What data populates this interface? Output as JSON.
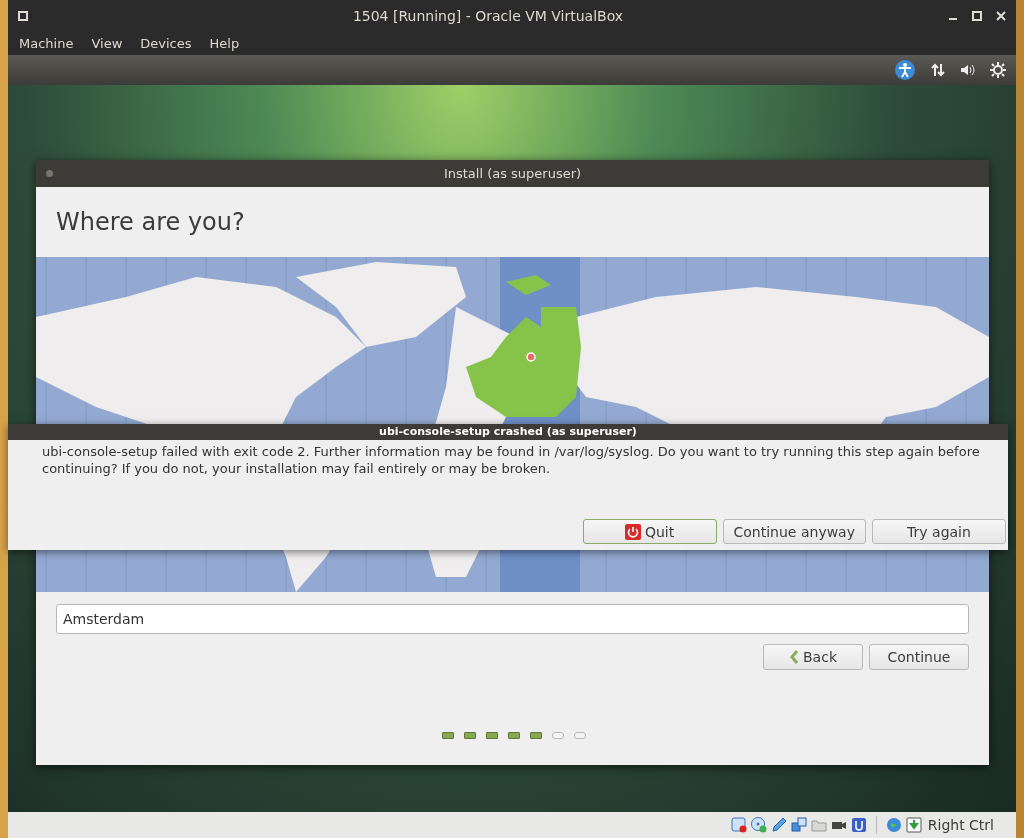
{
  "window": {
    "title": "1504 [Running] - Oracle VM VirtualBox"
  },
  "menu": [
    "Machine",
    "View",
    "Devices",
    "Help"
  ],
  "installer": {
    "title": "Install (as superuser)",
    "heading": "Where are you?",
    "location": {
      "value": "Amsterdam"
    },
    "buttons": [
      {
        "label": "Back",
        "kind": "back"
      },
      {
        "label": "Continue",
        "kind": "plain"
      }
    ],
    "steps": [
      {
        "done": true
      },
      {
        "done": true
      },
      {
        "done": true
      },
      {
        "done": true
      },
      {
        "done": true
      },
      {
        "done": false
      },
      {
        "done": false
      }
    ]
  },
  "dialog": {
    "title": "ubi-console-setup crashed (as superuser)",
    "message": "ubi-console-setup failed with exit code 2. Further information may be found in /var/log/syslog. Do you want to try running this step again before continuing? If you do not, your installation may fail entirely or may be broken.",
    "buttons": [
      {
        "label": "Quit",
        "kind": "quit",
        "focused": true
      },
      {
        "label": "Continue anyway",
        "kind": "plain",
        "focused": false
      },
      {
        "label": "Try again",
        "kind": "plain",
        "focused": false
      }
    ]
  },
  "status_bar": {
    "host_key": "Right Ctrl"
  }
}
